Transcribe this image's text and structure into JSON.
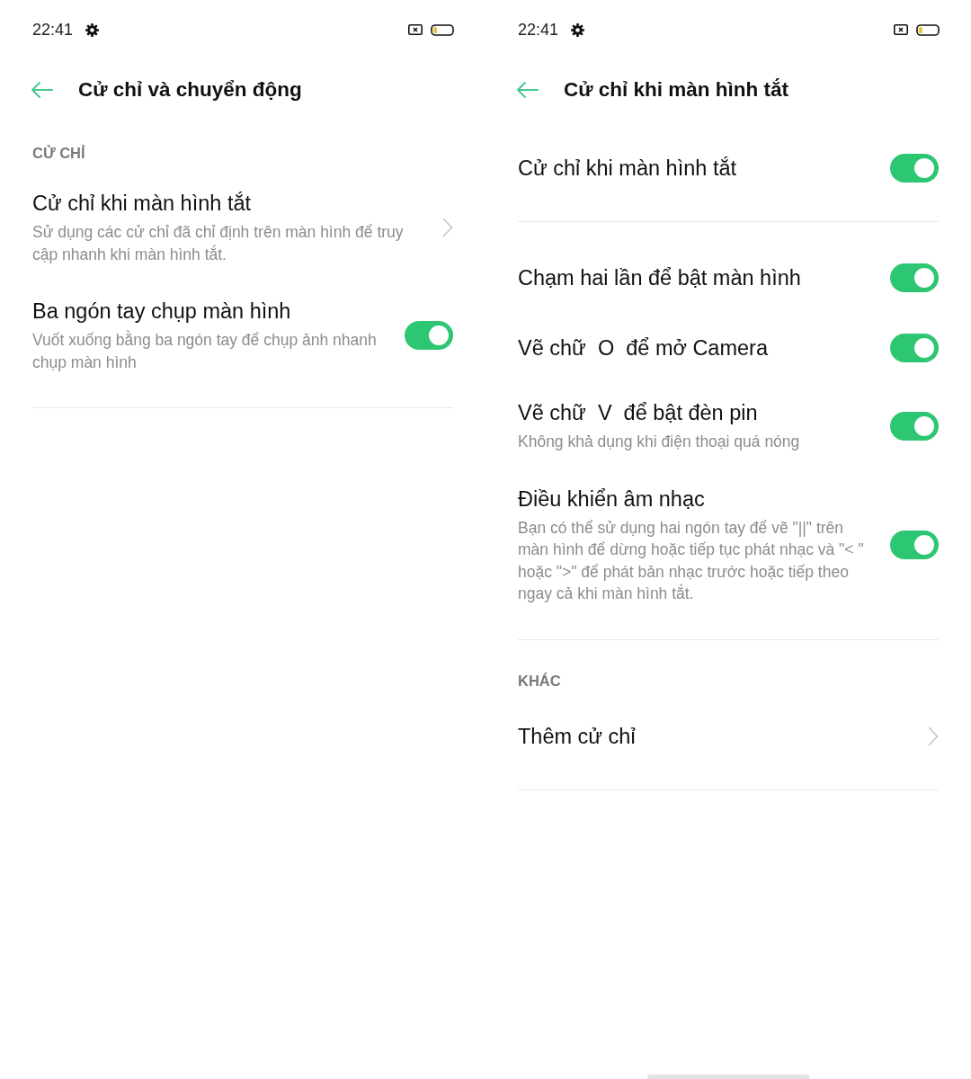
{
  "screens": [
    {
      "status_bar": {
        "time": "22:41"
      },
      "title": "Cử chỉ và chuyển động",
      "gesture_bar": false,
      "sections": [
        {
          "header": "CỬ CHỈ",
          "items": [
            {
              "kind": "link",
              "title": "Cử chỉ khi màn hình tắt",
              "subtitle": "Sử dụng các cử chỉ đã chỉ định trên màn hình để truy cập nhanh khi màn hình tắt."
            },
            {
              "kind": "toggle",
              "title": "Ba ngón tay chụp màn hình",
              "subtitle": "Vuốt xuống bằng ba ngón tay để chụp ảnh nhanh chụp màn hình",
              "on": true
            }
          ]
        }
      ]
    },
    {
      "status_bar": {
        "time": "22:41"
      },
      "title": "Cử chỉ khi màn hình tắt",
      "gesture_bar": true,
      "sections": [
        {
          "items": [
            {
              "kind": "toggle",
              "title": "Cử chỉ khi màn hình tắt",
              "on": true
            }
          ]
        },
        {
          "items": [
            {
              "kind": "toggle",
              "title": "Chạm hai lần để bật màn hình",
              "on": true
            },
            {
              "kind": "toggle",
              "title": "Vẽ chữ  O  để mở Camera",
              "on": true
            },
            {
              "kind": "toggle",
              "title": "Vẽ chữ  V  để bật đèn pin",
              "subtitle": "Không khả dụng khi điện thoại quá nóng",
              "on": true
            },
            {
              "kind": "toggle",
              "title": "Điều khiển âm nhạc",
              "subtitle": "Bạn có thể sử dụng hai ngón tay để vẽ \"||\" trên màn hình để dừng hoặc tiếp tục phát nhạc và \"< \" hoặc \">\" để phát bản nhạc trước hoặc tiếp theo ngay cả khi màn hình tắt.",
              "on": true
            }
          ]
        },
        {
          "header": "KHÁC",
          "items": [
            {
              "kind": "link",
              "title": "Thêm cử chỉ"
            }
          ]
        }
      ]
    }
  ]
}
